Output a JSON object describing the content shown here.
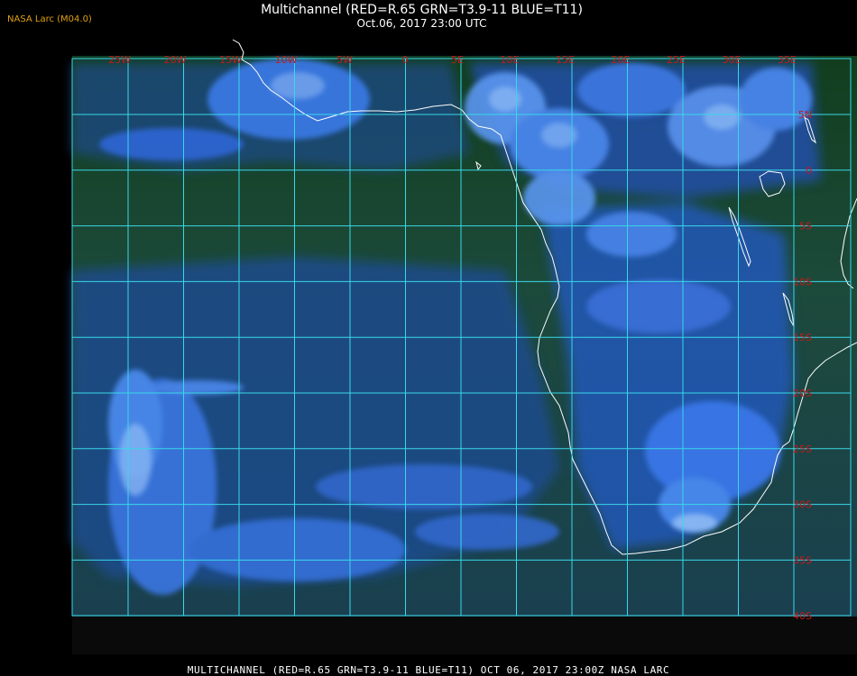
{
  "header": {
    "credit": "NASA Larc (M04.0)",
    "title": "Multichannel (RED=R.65 GRN=T3.9-11 BLUE=T11)",
    "subtitle": "Oct.06, 2017 23:00 UTC"
  },
  "footer": {
    "caption": "MULTICHANNEL (RED=R.65 GRN=T3.9-11 BLUE=T11) OCT 06, 2017 23:00Z   NASA LARC"
  },
  "map": {
    "longitude_labels": [
      "25W",
      "20W",
      "15W",
      "10W",
      "5W",
      "0",
      "5E",
      "10E",
      "15E",
      "20E",
      "25E",
      "30E",
      "35E"
    ],
    "latitude_labels": [
      "5N",
      "0",
      "5S",
      "10S",
      "15S",
      "20S",
      "25S",
      "30S",
      "35S",
      "40S"
    ],
    "colors": {
      "grid": "#38d8e8",
      "coastline": "#ffffff",
      "grid_label": "#c81818",
      "credit": "#e0a010",
      "ocean": "#1a4a2a",
      "cloud": "#2a6ae0"
    }
  }
}
